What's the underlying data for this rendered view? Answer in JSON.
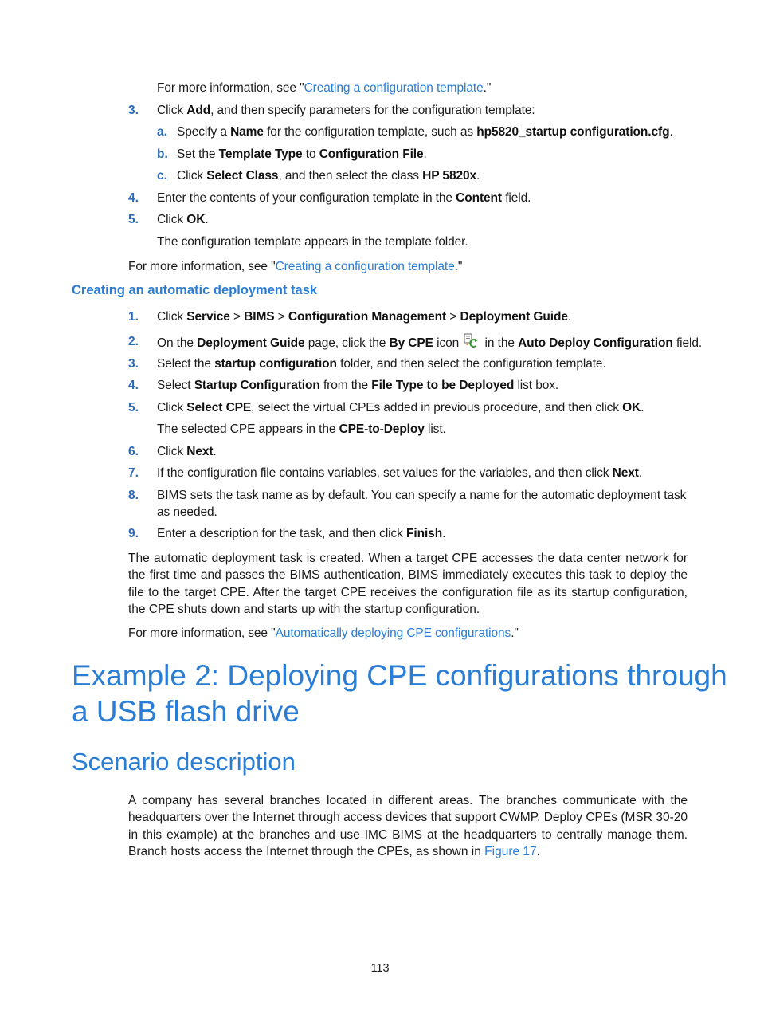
{
  "top_section": {
    "intro_prefix": "For more information, see \"",
    "intro_link": "Creating a configuration template",
    "intro_suffix": ".\"",
    "steps": [
      {
        "num": "3.",
        "p1": "Click ",
        "b1": "Add",
        "p2": ", and then specify parameters for the configuration template:"
      },
      {
        "num": "4.",
        "p1": "Enter the contents of your configuration template in the ",
        "b1": "Content",
        "p2": " field."
      },
      {
        "num": "5.",
        "p1": "Click ",
        "b1": "OK",
        "p2": ".",
        "note": "The configuration template appears in the template folder."
      }
    ],
    "substeps": [
      {
        "num": "a.",
        "p1": "Specify a ",
        "b1": "Name",
        "p2": " for the configuration template, such as ",
        "b2": "hp5820_startup configuration.cfg",
        "p3": "."
      },
      {
        "num": "b.",
        "p1": "Set the ",
        "b1": "Template Type",
        "p2": " to ",
        "b2": "Configuration File",
        "p3": "."
      },
      {
        "num": "c.",
        "p1": "Click ",
        "b1": "Select Class",
        "p2": ", and then select the class ",
        "b2": "HP 5820x",
        "p3": "."
      }
    ],
    "more_prefix": "For more information, see \"",
    "more_link": "Creating a configuration template",
    "more_suffix": ".\""
  },
  "task_section": {
    "heading": "Creating an automatic deployment task",
    "steps": [
      {
        "num": "1.",
        "p1": "Click ",
        "b1": "Service",
        "p2": " > ",
        "b2": "BIMS",
        "p3": " > ",
        "b3": "Configuration Management",
        "p4": " > ",
        "b4": "Deployment Guide",
        "p5": "."
      },
      {
        "num": "2.",
        "p1": "On the ",
        "b1": "Deployment Guide",
        "p2": " page, click the ",
        "b2": "By CPE",
        "p3": " icon ",
        "icon": "by-cpe-icon",
        "p4": " in the ",
        "b3": "Auto Deploy Configuration",
        "p5": " field."
      },
      {
        "num": "3.",
        "p1": "Select the ",
        "b1": "startup configuration",
        "p2": " folder, and then select the configuration template."
      },
      {
        "num": "4.",
        "p1": "Select ",
        "b1": "Startup Configuration",
        "p2": " from the ",
        "b2": "File Type to be Deployed",
        "p3": " list box."
      },
      {
        "num": "5.",
        "p1": "Click ",
        "b1": "Select CPE",
        "p2": ", select the virtual CPEs added in previous procedure, and then click ",
        "b2": "OK",
        "p3": ".",
        "note_p1": "The selected CPE appears in the ",
        "note_b1": "CPE-to-Deploy",
        "note_p2": " list."
      },
      {
        "num": "6.",
        "p1": "Click ",
        "b1": "Next",
        "p2": "."
      },
      {
        "num": "7.",
        "p1": "If the configuration file contains variables, set values for the variables, and then click ",
        "b1": "Next",
        "p2": "."
      },
      {
        "num": "8.",
        "line1": "BIMS sets the task name as by default. You can specify a name for the automatic deployment task",
        "line2": "as needed."
      },
      {
        "num": "9.",
        "p1": "Enter a description for the task, and then click ",
        "b1": "Finish",
        "p2": "."
      }
    ],
    "result_paragraph": "The automatic deployment task is created. When a target CPE accesses the data center network for the first time and passes the BIMS authentication, BIMS immediately executes this task to deploy the file to the target CPE. After the target CPE receives the configuration file as its startup configuration, the CPE shuts down and starts up with the startup configuration.",
    "more_prefix": "For more information, see \"",
    "more_link": "Automatically deploying CPE configurations",
    "more_suffix": ".\""
  },
  "example": {
    "title_line1": "Example 2: Deploying CPE configurations through",
    "title_line2": "a USB flash drive",
    "section_title": "Scenario description",
    "paragraph_text": "A company has several branches located in different areas. The branches communicate with the headquarters over the Internet through access devices that support CWMP. Deploy CPEs (MSR 30-20 in this example) at the branches and use IMC BIMS at the headquarters to centrally manage them. Branch hosts access the Internet through the CPEs, as shown in ",
    "paragraph_link": "Figure 17",
    "paragraph_end": "."
  },
  "page_number": "113"
}
